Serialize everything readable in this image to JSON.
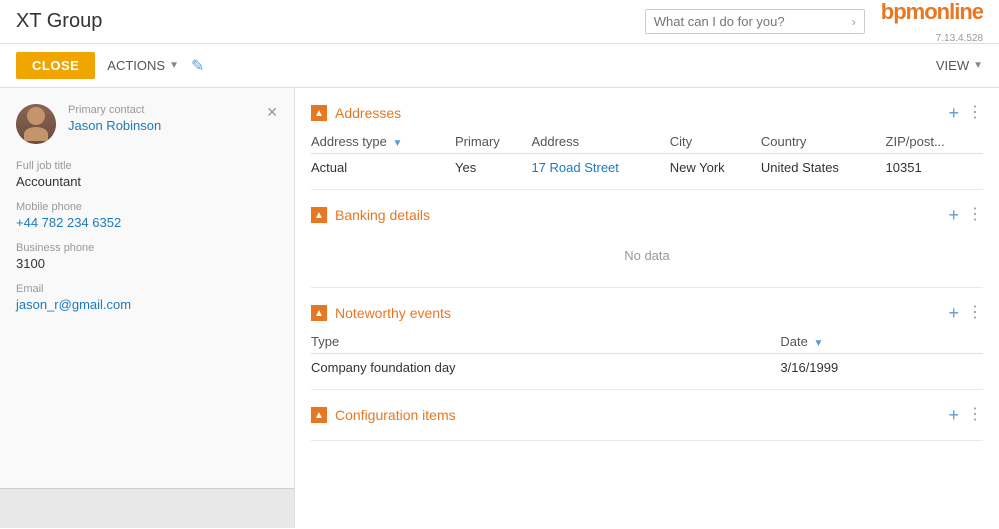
{
  "app": {
    "title": "XT Group",
    "logo": "bpmonline",
    "version": "7.13.4.528"
  },
  "search": {
    "placeholder": "What can I do for you?"
  },
  "toolbar": {
    "close_label": "CLOSE",
    "actions_label": "ACTIONS",
    "view_label": "VIEW"
  },
  "sidebar": {
    "primary_contact_label": "Primary contact",
    "primary_contact_name": "Jason Robinson",
    "full_job_title_label": "Full job title",
    "full_job_title_value": "Accountant",
    "mobile_phone_label": "Mobile phone",
    "mobile_phone_value": "+44 782 234 6352",
    "business_phone_label": "Business phone",
    "business_phone_value": "3100",
    "email_label": "Email",
    "email_value": "jason_r@gmail.com"
  },
  "sections": {
    "addresses": {
      "title": "Addresses",
      "columns": [
        "Address type",
        "Primary",
        "Address",
        "City",
        "Country",
        "ZIP/post..."
      ],
      "rows": [
        {
          "address_type": "Actual",
          "primary": "Yes",
          "address": "17 Road Street",
          "city": "New York",
          "country": "United States",
          "zip": "10351"
        }
      ]
    },
    "banking_details": {
      "title": "Banking details",
      "no_data": "No data"
    },
    "noteworthy_events": {
      "title": "Noteworthy events",
      "columns": [
        "Type",
        "Date"
      ],
      "rows": [
        {
          "type": "Company foundation day",
          "date": "3/16/1999"
        }
      ]
    },
    "configuration_items": {
      "title": "Configuration items"
    }
  }
}
